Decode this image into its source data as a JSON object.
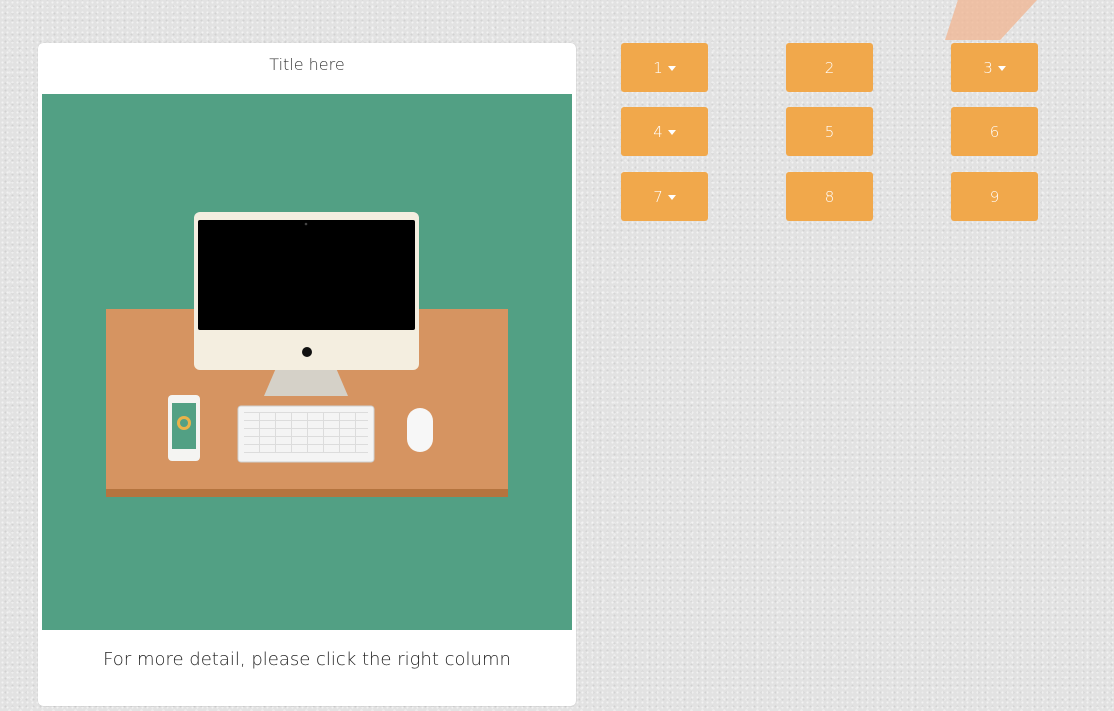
{
  "card": {
    "title": "Title here",
    "caption": "For more detail, please click the right column"
  },
  "buttons": [
    {
      "label": "1",
      "dropdown": true
    },
    {
      "label": "2",
      "dropdown": false
    },
    {
      "label": "3",
      "dropdown": true
    },
    {
      "label": "4",
      "dropdown": true
    },
    {
      "label": "5",
      "dropdown": false
    },
    {
      "label": "6",
      "dropdown": false
    },
    {
      "label": "7",
      "dropdown": true
    },
    {
      "label": "8",
      "dropdown": false
    },
    {
      "label": "9",
      "dropdown": false
    }
  ],
  "colors": {
    "button": "#f1a84b",
    "image_bg": "#52a084",
    "desk": "#d69461"
  }
}
